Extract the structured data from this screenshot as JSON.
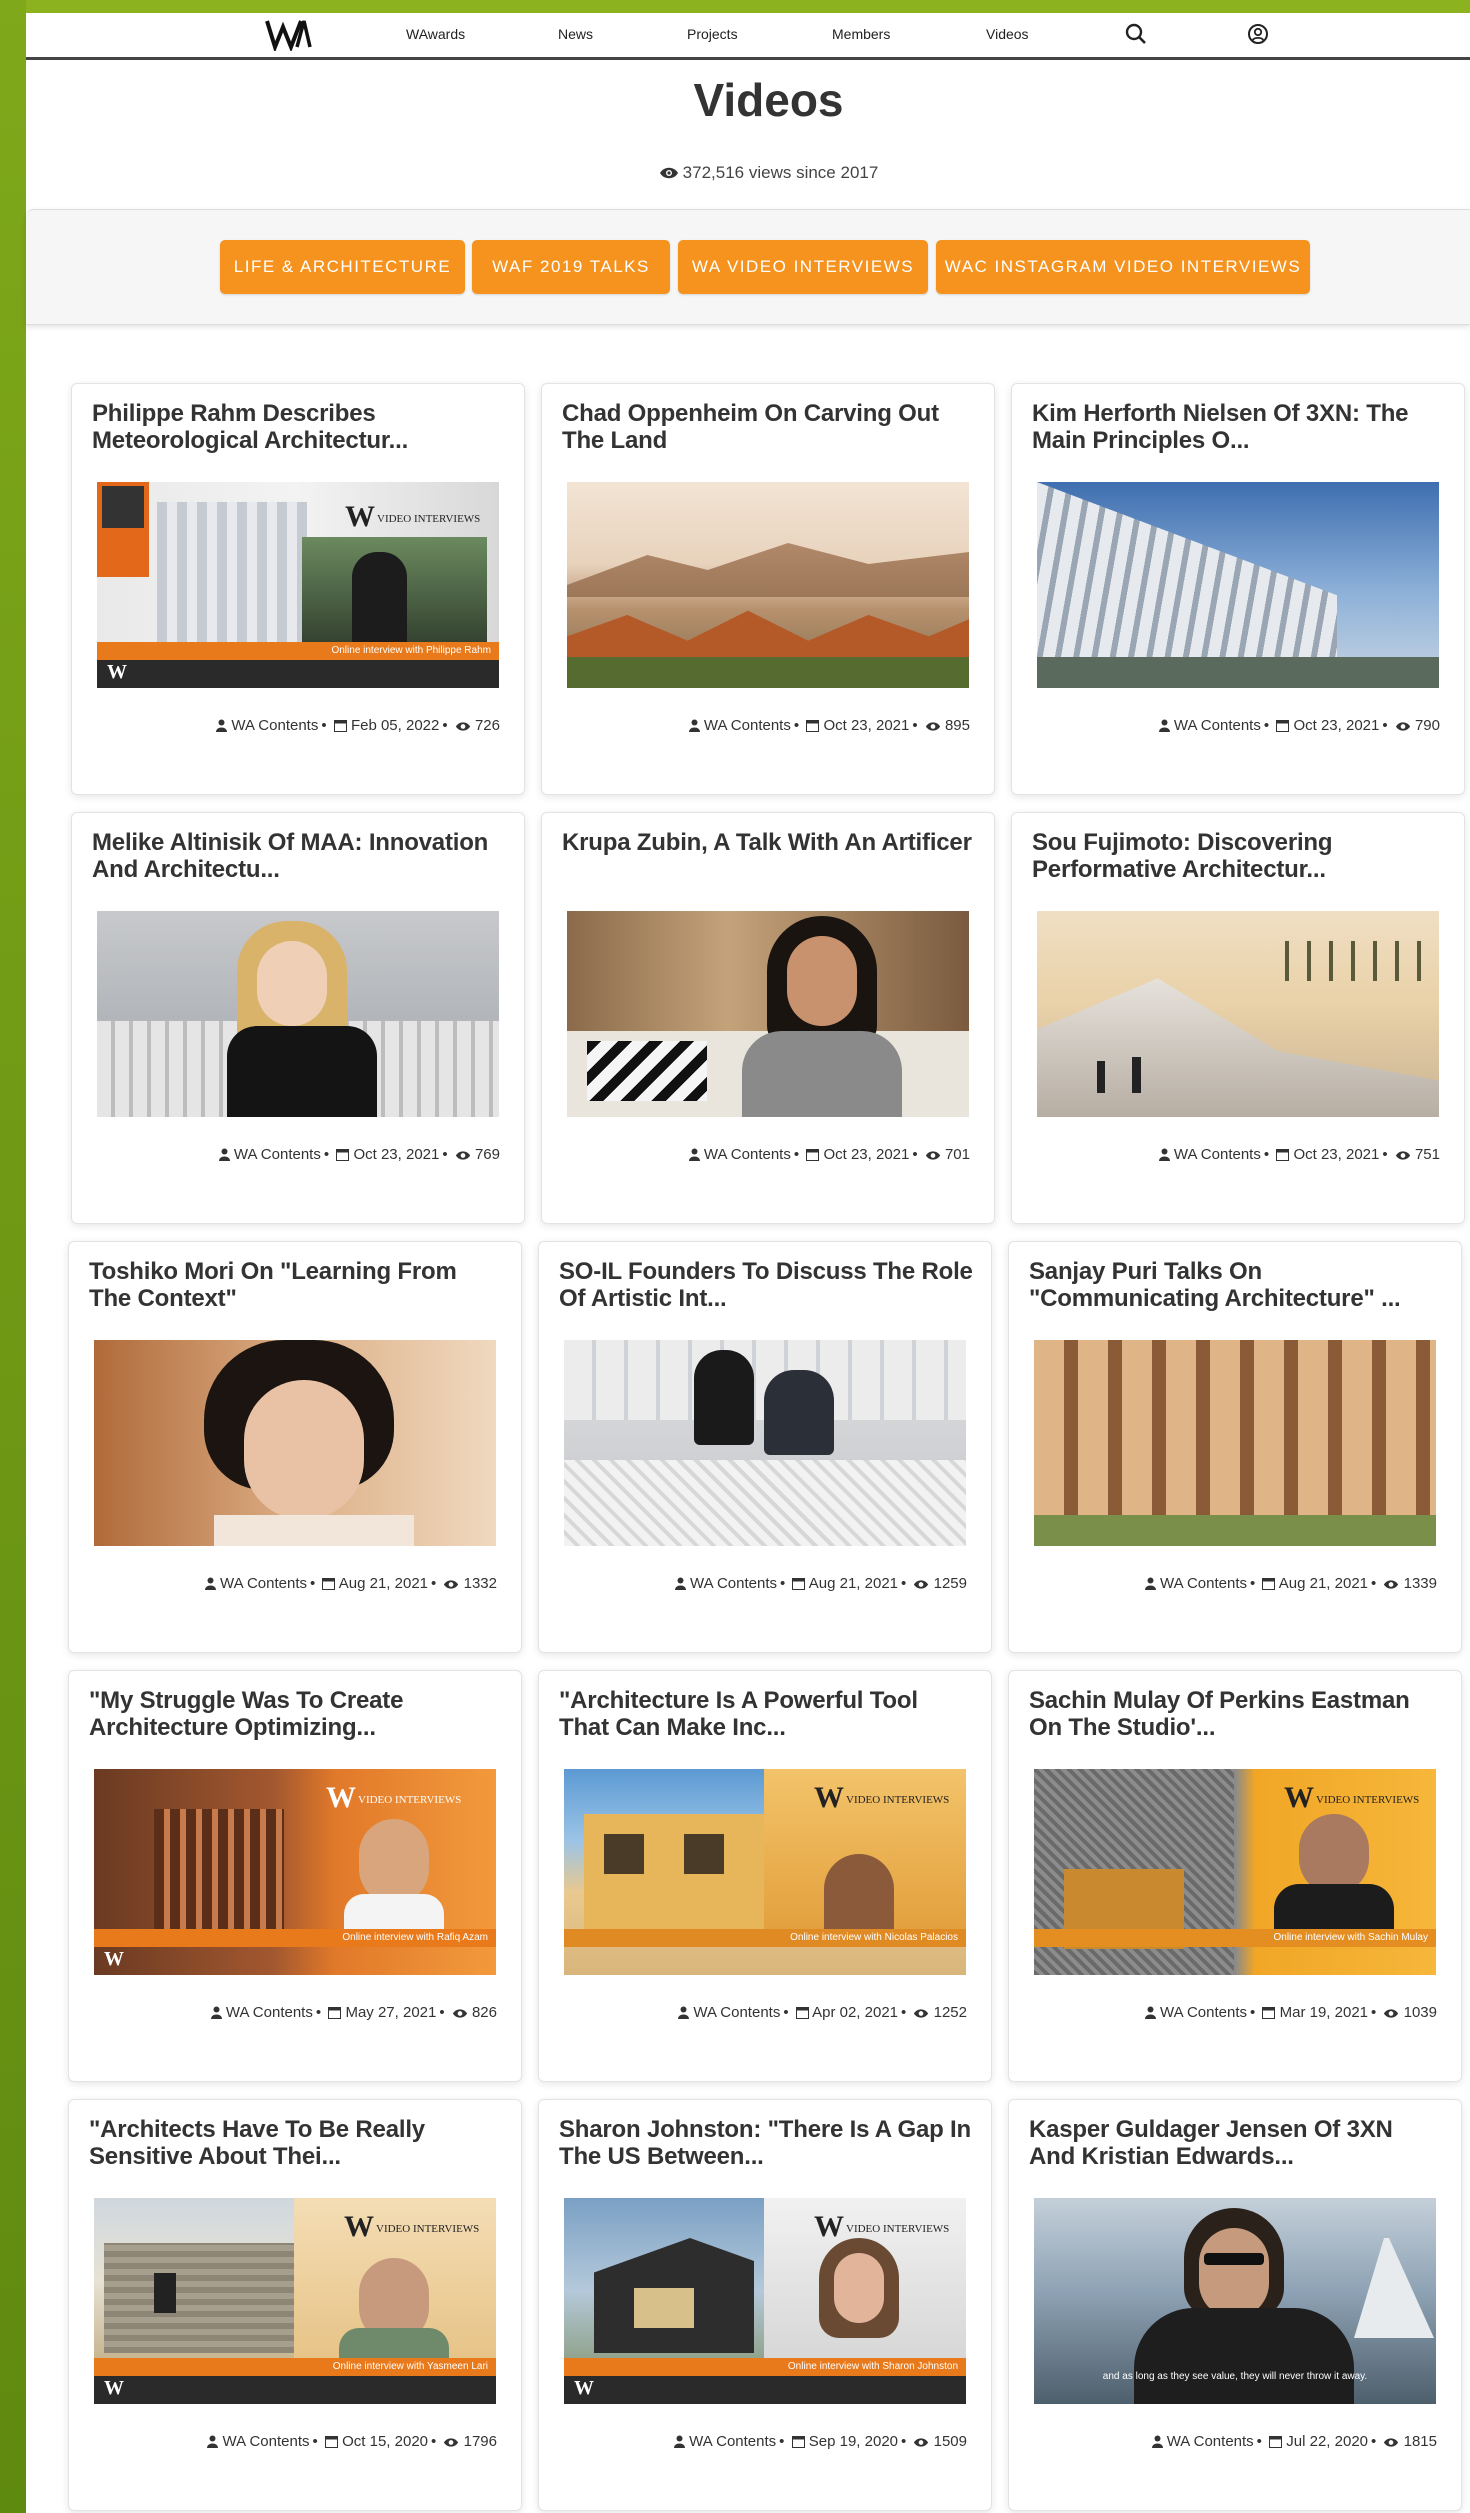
{
  "nav": {
    "items": [
      "WAwards",
      "News",
      "Projects",
      "Members",
      "Videos"
    ]
  },
  "header": {
    "title": "Videos",
    "views": "372,516 views since 2017"
  },
  "tabs": [
    "LIFE & ARCHITECTURE",
    "WAF 2019 TALKS",
    "WA VIDEO INTERVIEWS",
    "WAC INSTAGRAM VIDEO INTERVIEWS"
  ],
  "cards": [
    {
      "title": "Philippe Rahm Describes Meteorological Architectur...",
      "author": "WA Contents",
      "date": "Feb 05, 2022",
      "views": "726",
      "caption": "Online interview with Philippe Rahm"
    },
    {
      "title": "Chad Oppenheim On Carving Out The Land",
      "author": "WA Contents",
      "date": "Oct 23, 2021",
      "views": "895"
    },
    {
      "title": "Kim Herforth Nielsen Of 3XN: The Main Principles O...",
      "author": "WA Contents",
      "date": "Oct 23, 2021",
      "views": "790"
    },
    {
      "title": "Melike Altinisik Of MAA: Innovation And Architectu...",
      "author": "WA Contents",
      "date": "Oct 23, 2021",
      "views": "769"
    },
    {
      "title": "Krupa Zubin, A Talk With An Artificer",
      "author": "WA Contents",
      "date": "Oct 23, 2021",
      "views": "701"
    },
    {
      "title": "Sou Fujimoto: Discovering Performative Architectur...",
      "author": "WA Contents",
      "date": "Oct 23, 2021",
      "views": "751"
    },
    {
      "title": "Toshiko Mori On \"Learning From The Context\"",
      "author": "WA Contents",
      "date": "Aug 21, 2021",
      "views": "1332"
    },
    {
      "title": "SO-IL Founders To Discuss The Role Of Artistic Int...",
      "author": "WA Contents",
      "date": "Aug 21, 2021",
      "views": "1259"
    },
    {
      "title": "Sanjay Puri Talks On \"Communicating Architecture\" ...",
      "author": "WA Contents",
      "date": "Aug 21, 2021",
      "views": "1339"
    },
    {
      "title": "\"My Struggle Was To Create Architecture Optimizing...",
      "author": "WA Contents",
      "date": "May 27, 2021",
      "views": "826",
      "caption": "Online interview with Rafiq Azam"
    },
    {
      "title": "\"Architecture Is A Powerful Tool That Can Make Inc...",
      "author": "WA Contents",
      "date": "Apr 02, 2021",
      "views": "1252",
      "caption": "Online interview with Nicolas Palacios"
    },
    {
      "title": "Sachin Mulay Of Perkins Eastman On The Studio'...",
      "author": "WA Contents",
      "date": "Mar 19, 2021",
      "views": "1039",
      "caption": "Online interview with Sachin Mulay"
    },
    {
      "title": "\"Architects Have To Be Really Sensitive About Thei...",
      "author": "WA Contents",
      "date": "Oct 15, 2020",
      "views": "1796",
      "caption": "Online interview with Yasmeen Lari"
    },
    {
      "title": "Sharon Johnston: \"There Is A Gap In The US Between...",
      "author": "WA Contents",
      "date": "Sep 19, 2020",
      "views": "1509",
      "caption": "Online interview with Sharon Johnston"
    },
    {
      "title": "Kasper Guldager Jensen Of 3XN And Kristian Edwards...",
      "author": "WA Contents",
      "date": "Jul 22, 2020",
      "views": "1815",
      "caption": "and as long as they see value, they will never throw it away."
    }
  ],
  "badge_text": "VIDEO INTERVIEWS",
  "colors": {
    "accent": "#f5931e",
    "frame": "#7fa81a"
  }
}
